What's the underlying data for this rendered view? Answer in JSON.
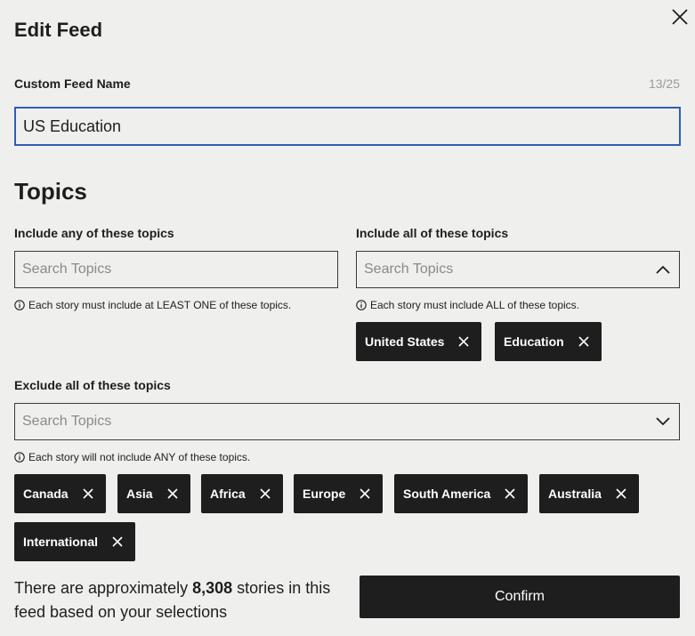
{
  "dialog": {
    "title": "Edit Feed",
    "close_icon": "close-icon"
  },
  "feed_name": {
    "label": "Custom Feed Name",
    "counter": "13/25",
    "value": "US Education"
  },
  "topics": {
    "heading": "Topics",
    "include_any": {
      "label": "Include any of these topics",
      "placeholder": "Search Topics",
      "hint": "Each story must include at LEAST ONE of these topics.",
      "chips": []
    },
    "include_all": {
      "label": "Include all of these topics",
      "placeholder": "Search Topics",
      "hint": "Each story must include ALL of these topics.",
      "chevron": "chevron-up-icon",
      "chips": [
        "United States",
        "Education"
      ]
    },
    "exclude": {
      "label": "Exclude all of these topics",
      "placeholder": "Search Topics",
      "hint": "Each story will not include ANY of these topics.",
      "chevron": "chevron-down-icon",
      "chips": [
        "Canada",
        "Asia",
        "Africa",
        "Europe",
        "South America",
        "Australia",
        "International"
      ]
    }
  },
  "footer": {
    "summary_prefix": "There are approximately",
    "story_count": "8,308",
    "summary_suffix": "stories in this feed based on your selections",
    "confirm_label": "Confirm"
  },
  "colors": {
    "background": "#efefed",
    "chip": "#1e1e1e",
    "focus_border": "#2d5fb3",
    "counter_text": "#9a9a9a"
  }
}
